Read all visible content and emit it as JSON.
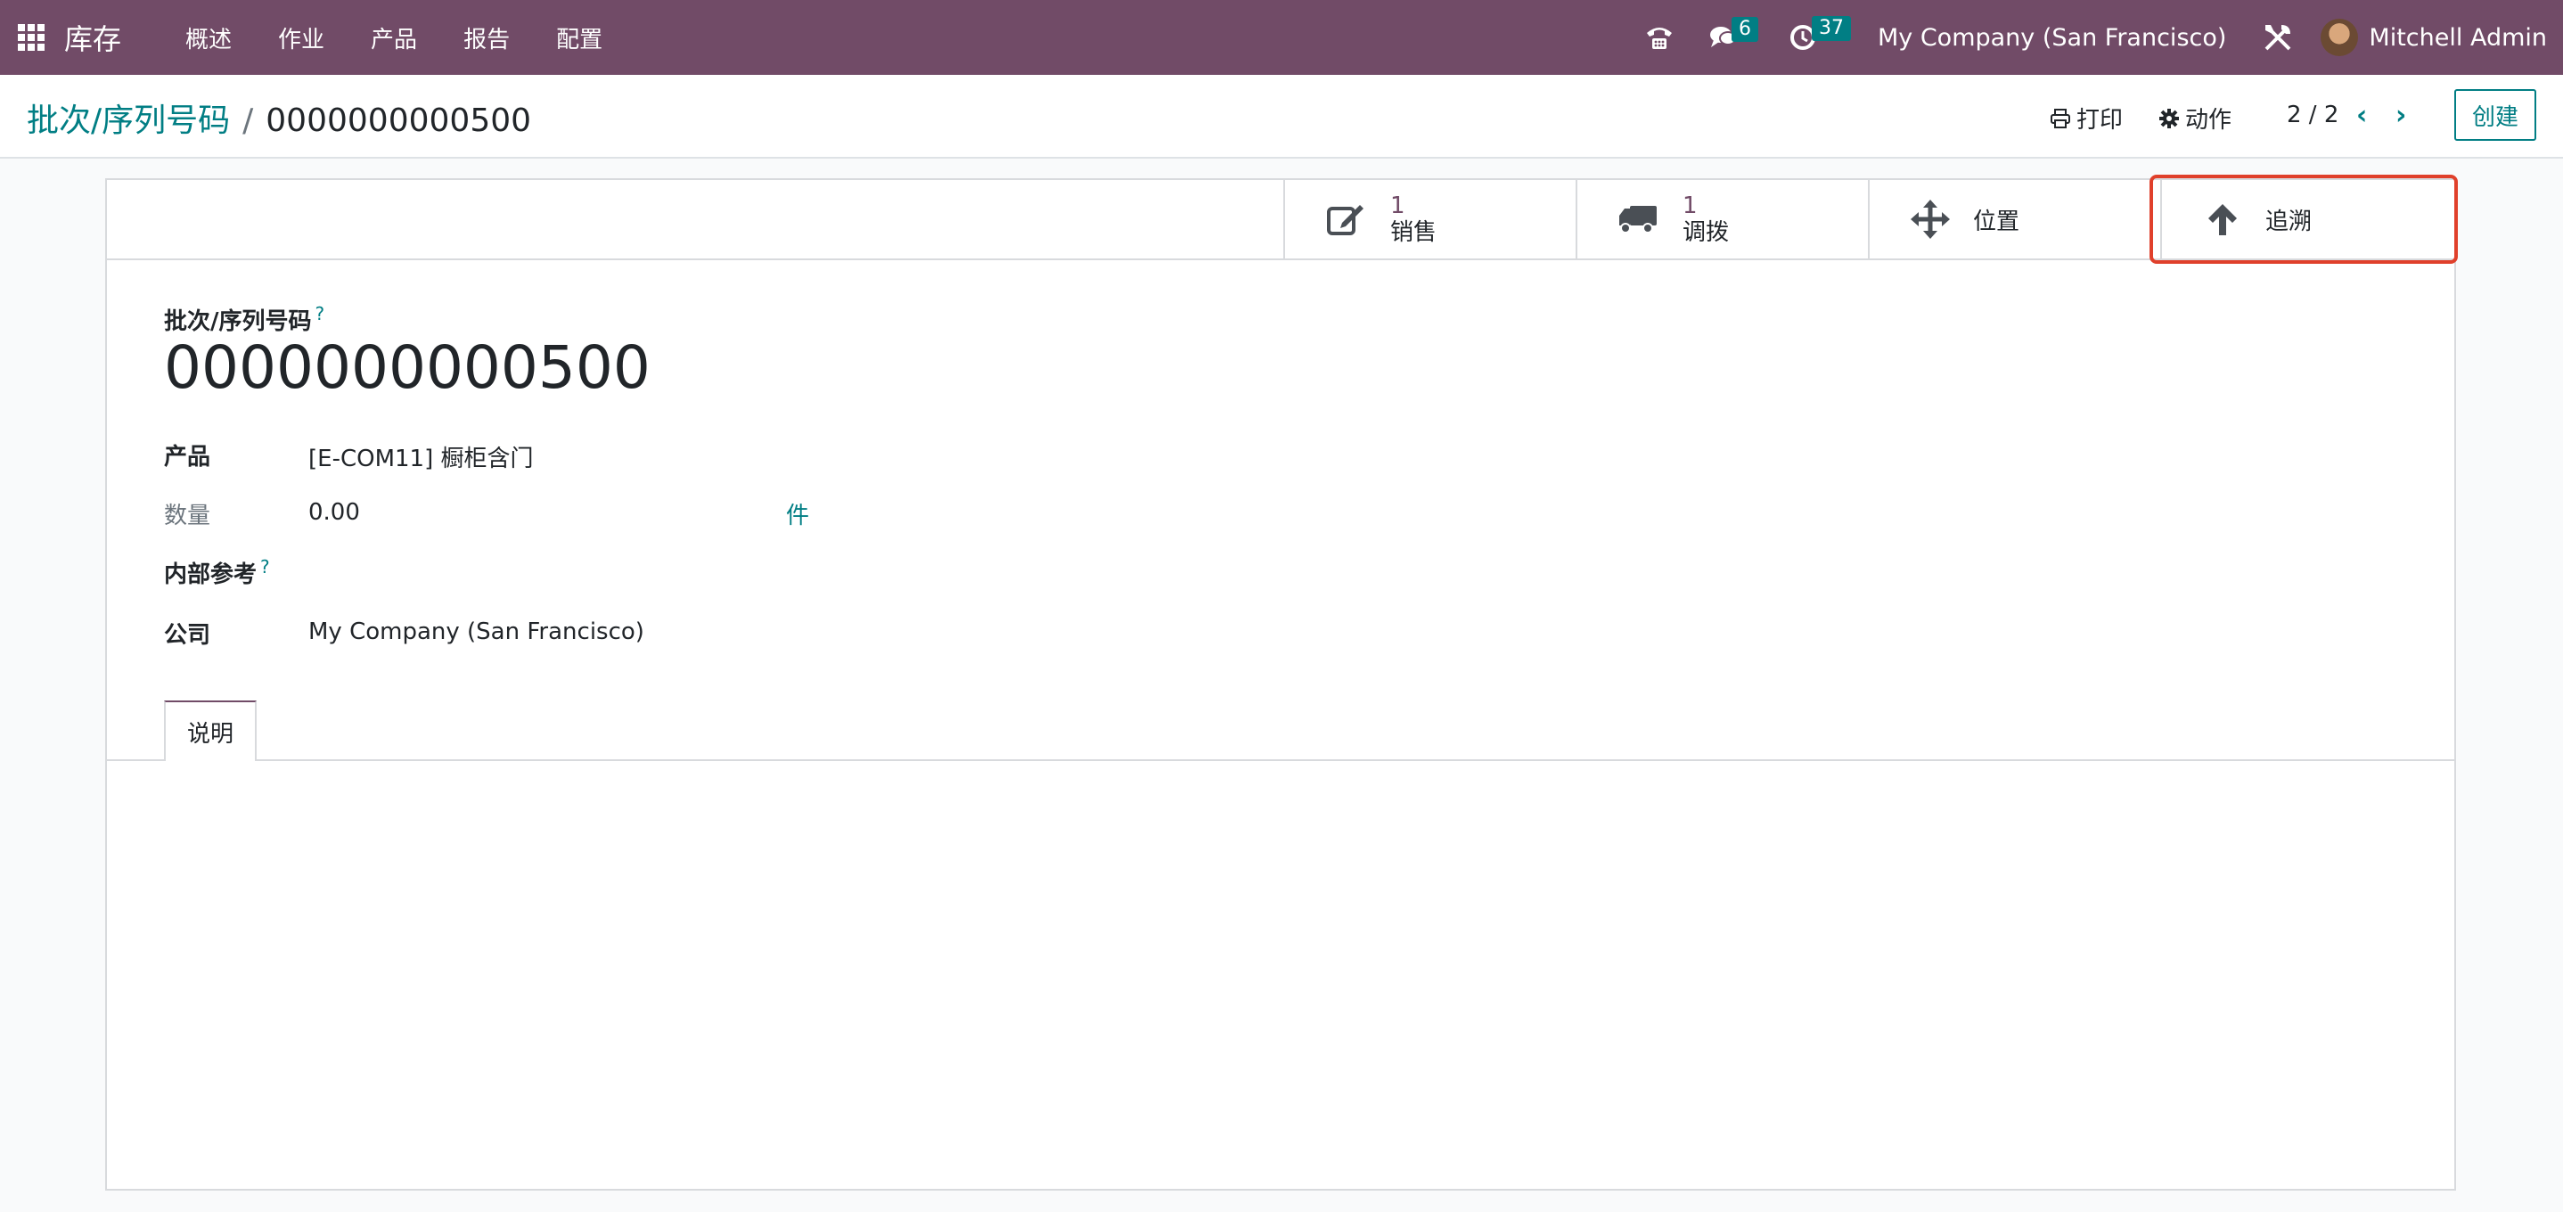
{
  "navbar": {
    "brand": "库存",
    "menu": [
      "概述",
      "作业",
      "产品",
      "报告",
      "配置"
    ],
    "messages_count": "6",
    "activities_count": "37",
    "company": "My Company (San Francisco)",
    "user": "Mitchell Admin"
  },
  "control_panel": {
    "breadcrumb_parent": "批次/序列号码",
    "breadcrumb_separator": "/",
    "breadcrumb_current": "0000000000500",
    "print_label": "打印",
    "action_label": "动作",
    "pager": "2 / 2",
    "create_label": "创建"
  },
  "smart_buttons": {
    "sales": {
      "count": "1",
      "label": "销售"
    },
    "transfers": {
      "count": "1",
      "label": "调拨"
    },
    "location": {
      "label": "位置"
    },
    "traceability": {
      "label": "追溯"
    }
  },
  "form": {
    "title_label": "批次/序列号码",
    "title_value": "0000000000500",
    "help_mark": "?",
    "product_label": "产品",
    "product_value": "[E-COM11] 橱柜含门",
    "quantity_label": "数量",
    "quantity_value": "0.00",
    "uom": "件",
    "internal_ref_label": "内部参考",
    "company_label": "公司",
    "company_value": "My Company (San Francisco)",
    "tab_description": "说明"
  },
  "colors": {
    "navbar": "#714b67",
    "accent": "#017e84",
    "highlight": "#e0402b"
  }
}
